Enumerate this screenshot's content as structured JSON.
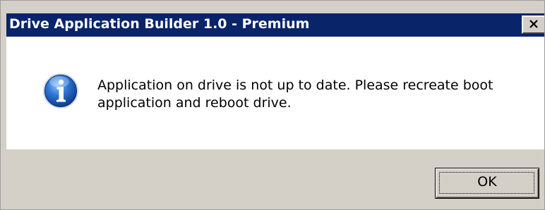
{
  "dialog": {
    "title": "Drive Application Builder 1.0 - Premium",
    "message": "Application on drive is not up to date. Please recreate boot application and reboot drive.",
    "icon": "information-icon",
    "ok_label": "OK",
    "close_icon": "close-icon"
  },
  "colors": {
    "titlebar": "#0a246a",
    "title_text": "#ffffff",
    "body_bg": "#ffffff",
    "footer_bg": "#d4d0c8",
    "icon_blue": "#1c5bb8"
  }
}
